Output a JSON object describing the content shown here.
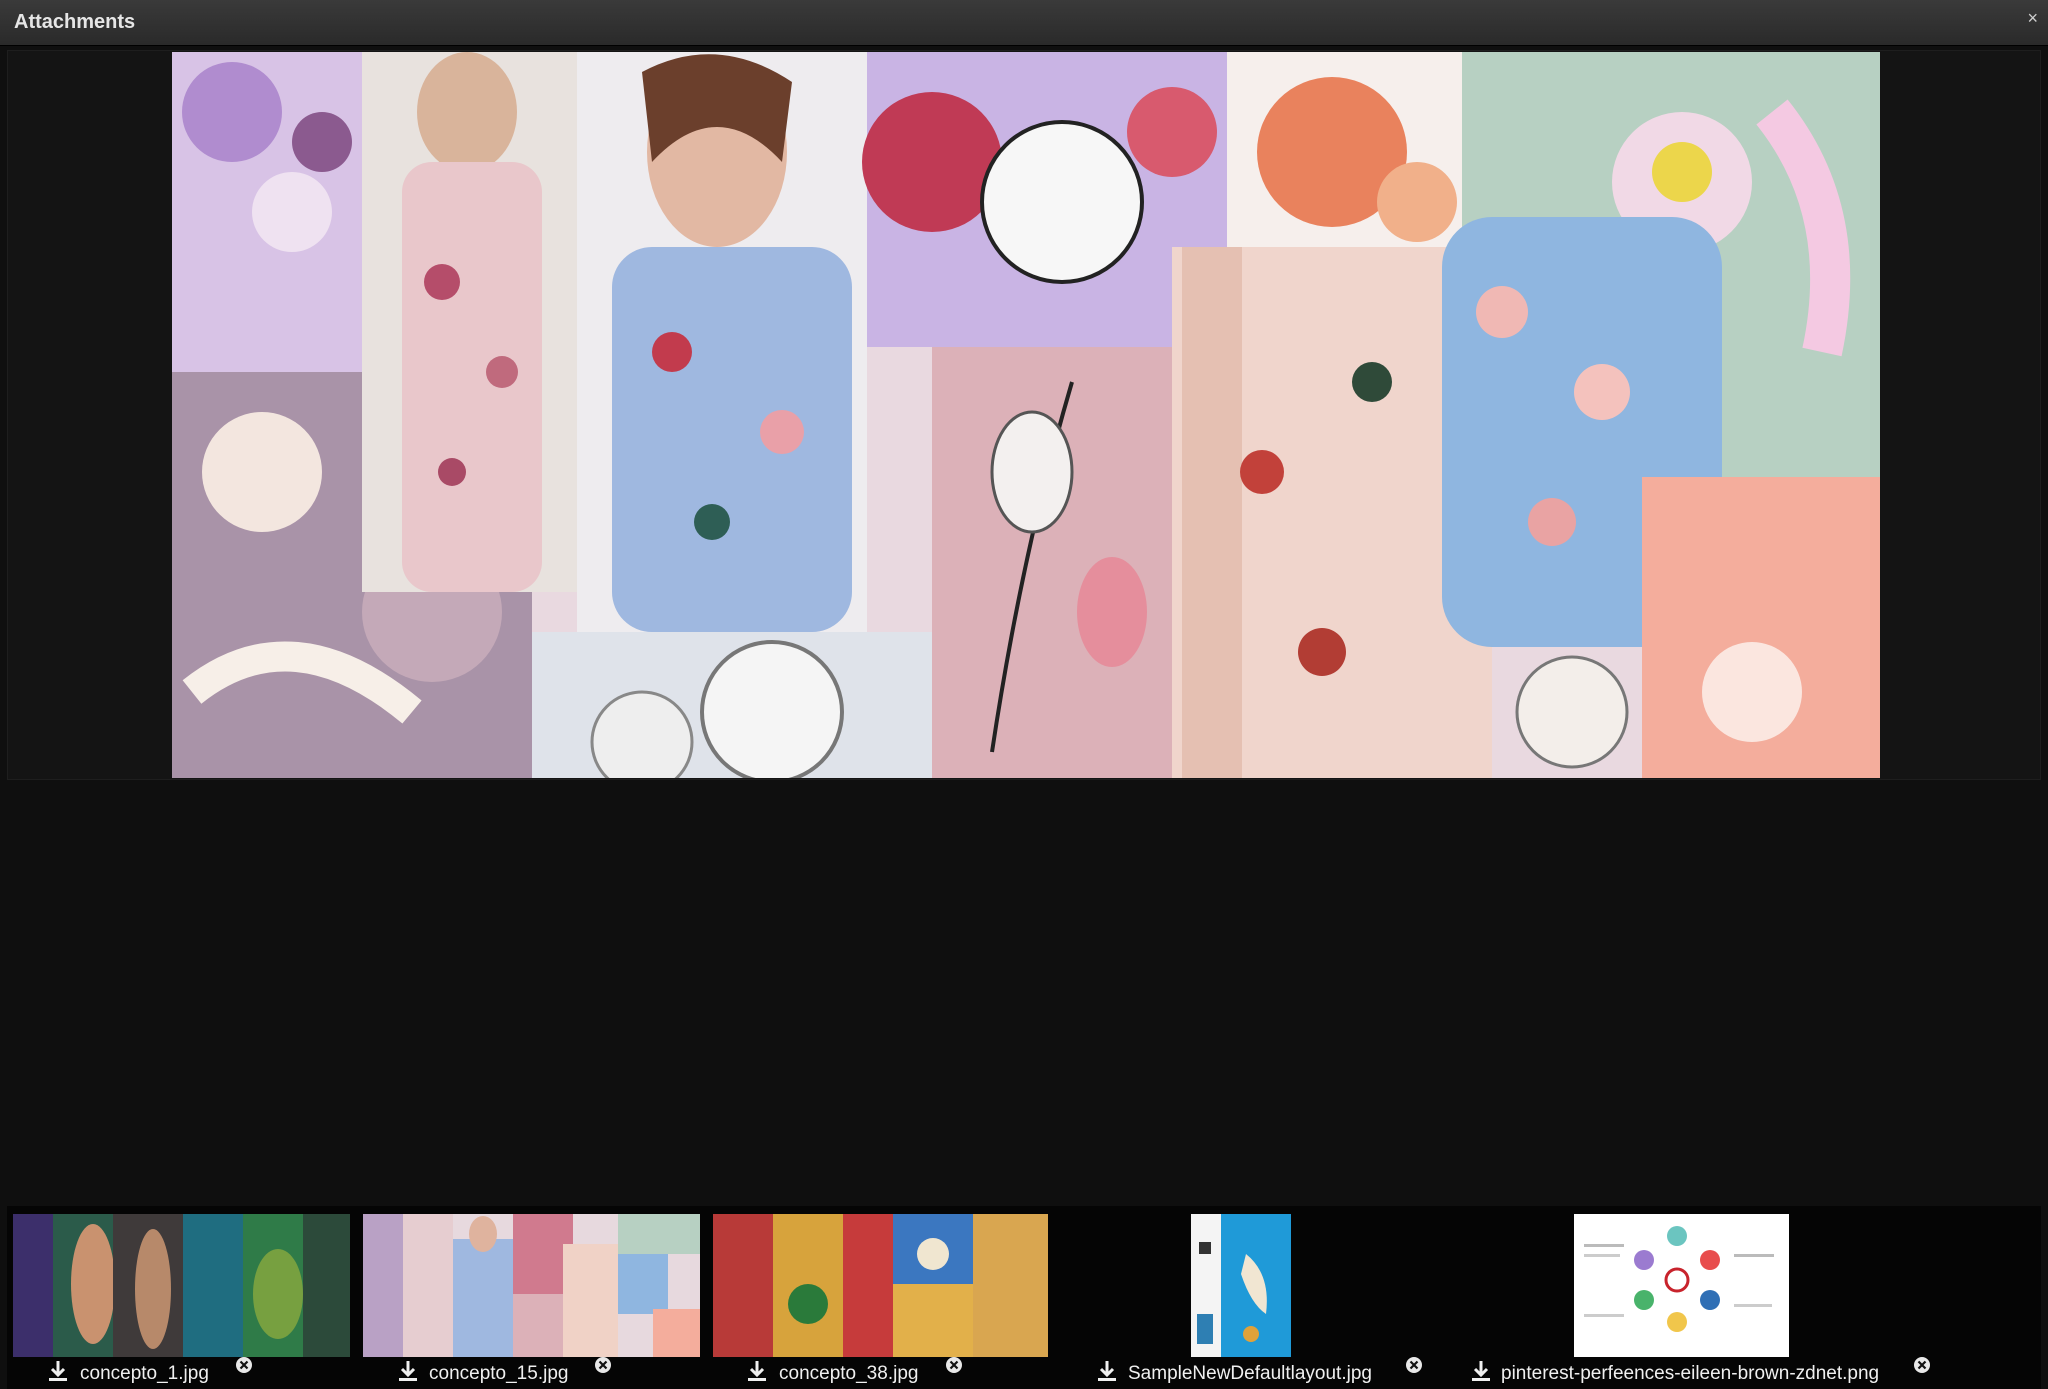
{
  "window": {
    "title": "Attachments",
    "close_glyph": "×"
  },
  "preview": {
    "image_name": "concepto_15.jpg"
  },
  "attachments": [
    {
      "file_name": "concepto_1.jpg",
      "download_icon": "download-icon",
      "remove_icon": "remove-icon"
    },
    {
      "file_name": "concepto_15.jpg",
      "download_icon": "download-icon",
      "remove_icon": "remove-icon"
    },
    {
      "file_name": "concepto_38.jpg",
      "download_icon": "download-icon",
      "remove_icon": "remove-icon"
    },
    {
      "file_name": "SampleNewDefaultlayout.jpg",
      "download_icon": "download-icon",
      "remove_icon": "remove-icon"
    },
    {
      "file_name": "pinterest-perfeences-eileen-brown-zdnet.png",
      "download_icon": "download-icon",
      "remove_icon": "remove-icon"
    }
  ],
  "colors": {
    "background": "#0f0f0f",
    "titlebar": "#2f2f2f",
    "text": "#f0f0f0"
  }
}
